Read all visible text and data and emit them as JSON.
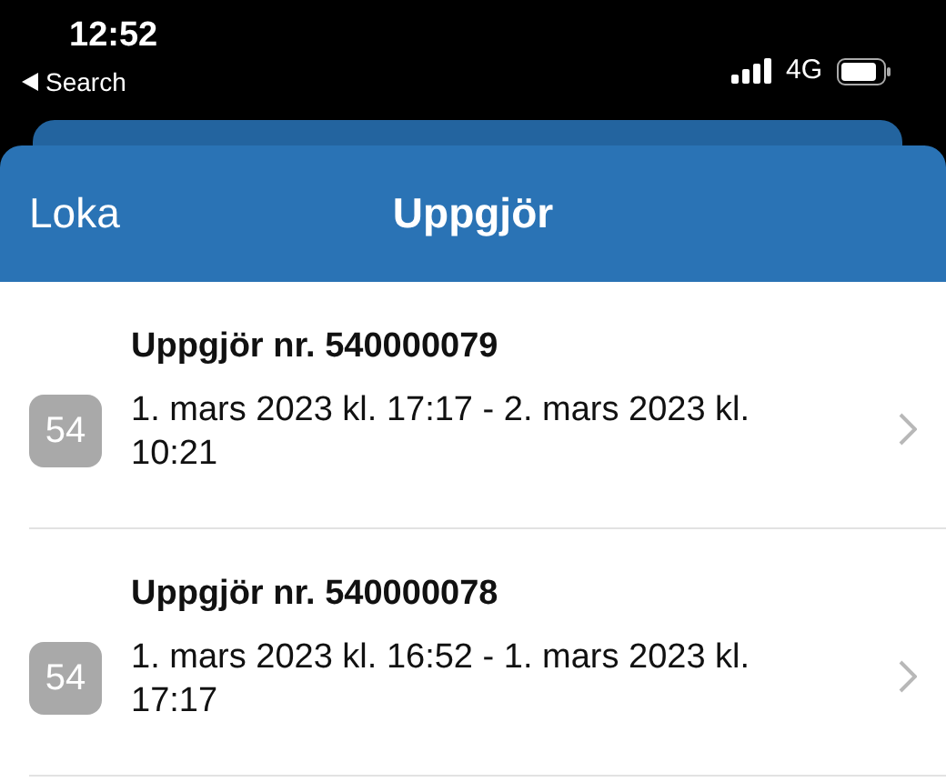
{
  "status_bar": {
    "time": "12:52",
    "back_label": "Search",
    "network": "4G"
  },
  "nav_bar": {
    "back_label": "Loka",
    "title": "Uppgjör"
  },
  "settlements": [
    {
      "badge": "54",
      "title": "Uppgjör nr. 540000079",
      "period": "1. mars 2023 kl. 17:17 - 2. mars 2023 kl. 10:21"
    },
    {
      "badge": "54",
      "title": "Uppgjör nr. 540000078",
      "period": "1. mars 2023 kl. 16:52 - 1. mars 2023 kl. 17:17"
    }
  ]
}
